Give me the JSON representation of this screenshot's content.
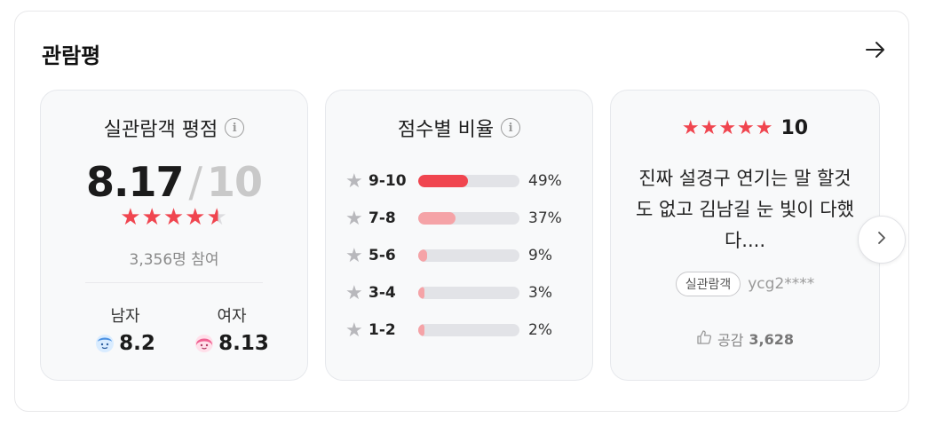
{
  "section": {
    "title": "관람평",
    "arrow_icon": "arrow-right-icon"
  },
  "rating_card": {
    "title": "실관람객 평점",
    "info_icon": "info-icon",
    "score": "8.17",
    "separator": "/",
    "max": "10",
    "stars_rating": 4.1,
    "participants": "3,356명 참여",
    "male": {
      "label": "남자",
      "score": "8.2",
      "icon": "male-avatar-icon"
    },
    "female": {
      "label": "여자",
      "score": "8.13",
      "icon": "female-avatar-icon"
    }
  },
  "distribution_card": {
    "title": "점수별 비율",
    "info_icon": "info-icon",
    "rows": [
      {
        "range": "9-10",
        "percent": "49%",
        "fraction": 0.49,
        "color": "#f0454f"
      },
      {
        "range": "7-8",
        "percent": "37%",
        "fraction": 0.37,
        "color": "#f5a3a7"
      },
      {
        "range": "5-6",
        "percent": "9%",
        "fraction": 0.09,
        "color": "#f5a3a7"
      },
      {
        "range": "3-4",
        "percent": "3%",
        "fraction": 0.03,
        "color": "#f5a3a7"
      },
      {
        "range": "1-2",
        "percent": "2%",
        "fraction": 0.02,
        "color": "#f5a3a7"
      }
    ]
  },
  "review_card": {
    "stars": "★★★★★",
    "score": "10",
    "text": "진짜 설경구 연기는 말 할것도 없고 김남길 눈 빛이 다했다....",
    "badge": "실관람객",
    "user": "ycg2****",
    "like_label": "공감",
    "like_count": "3,628",
    "like_icon": "thumbs-up-icon"
  },
  "next_button_icon": "chevron-right-icon",
  "colors": {
    "accent": "#f0454f",
    "accent_light": "#f5a3a7",
    "card_bg": "#f8f9fa"
  }
}
